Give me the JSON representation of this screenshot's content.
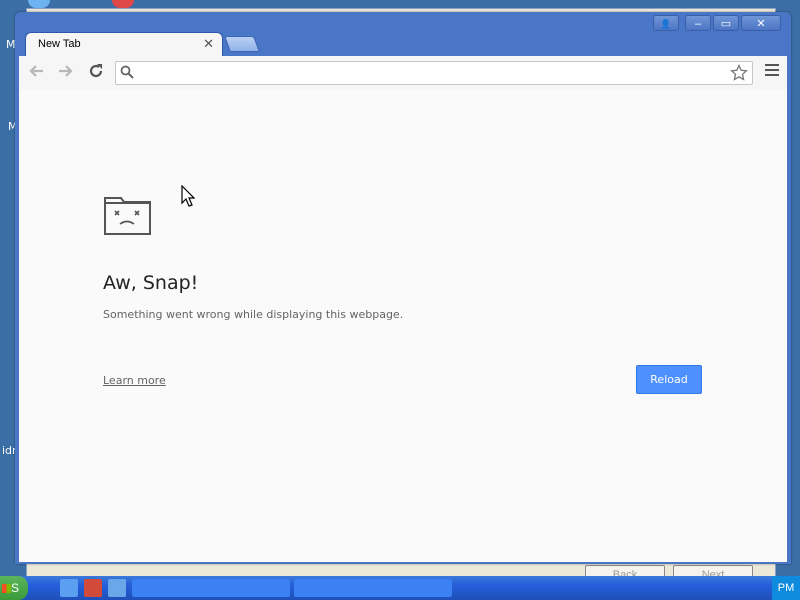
{
  "desktop": {
    "labels": [
      "M",
      "M",
      "idr"
    ]
  },
  "installer": {
    "back_label": "Back",
    "next_label": "Next"
  },
  "taskbar": {
    "start_label": "S",
    "clock_fragment": "PM"
  },
  "browser": {
    "tab": {
      "title": "New Tab",
      "close_glyph": "✕"
    },
    "window_buttons": {
      "profile": "👤",
      "minimize": "–",
      "maximize": "▭",
      "close": "✕"
    },
    "toolbar": {
      "back_icon": "back-arrow-icon",
      "forward_icon": "forward-arrow-icon",
      "reload_icon": "reload-icon",
      "omnibox_value": "",
      "omnibox_placeholder": "",
      "star_icon": "bookmark-star-icon",
      "menu_icon": "hamburger-menu-icon"
    },
    "error_page": {
      "heading": "Aw, Snap!",
      "message": "Something went wrong while displaying this webpage.",
      "learn_more": "Learn more",
      "reload_button": "Reload"
    }
  },
  "colors": {
    "accent": "#4d90fe",
    "desktop": "#3a6ea5",
    "window_frame": "#4a76c8"
  }
}
